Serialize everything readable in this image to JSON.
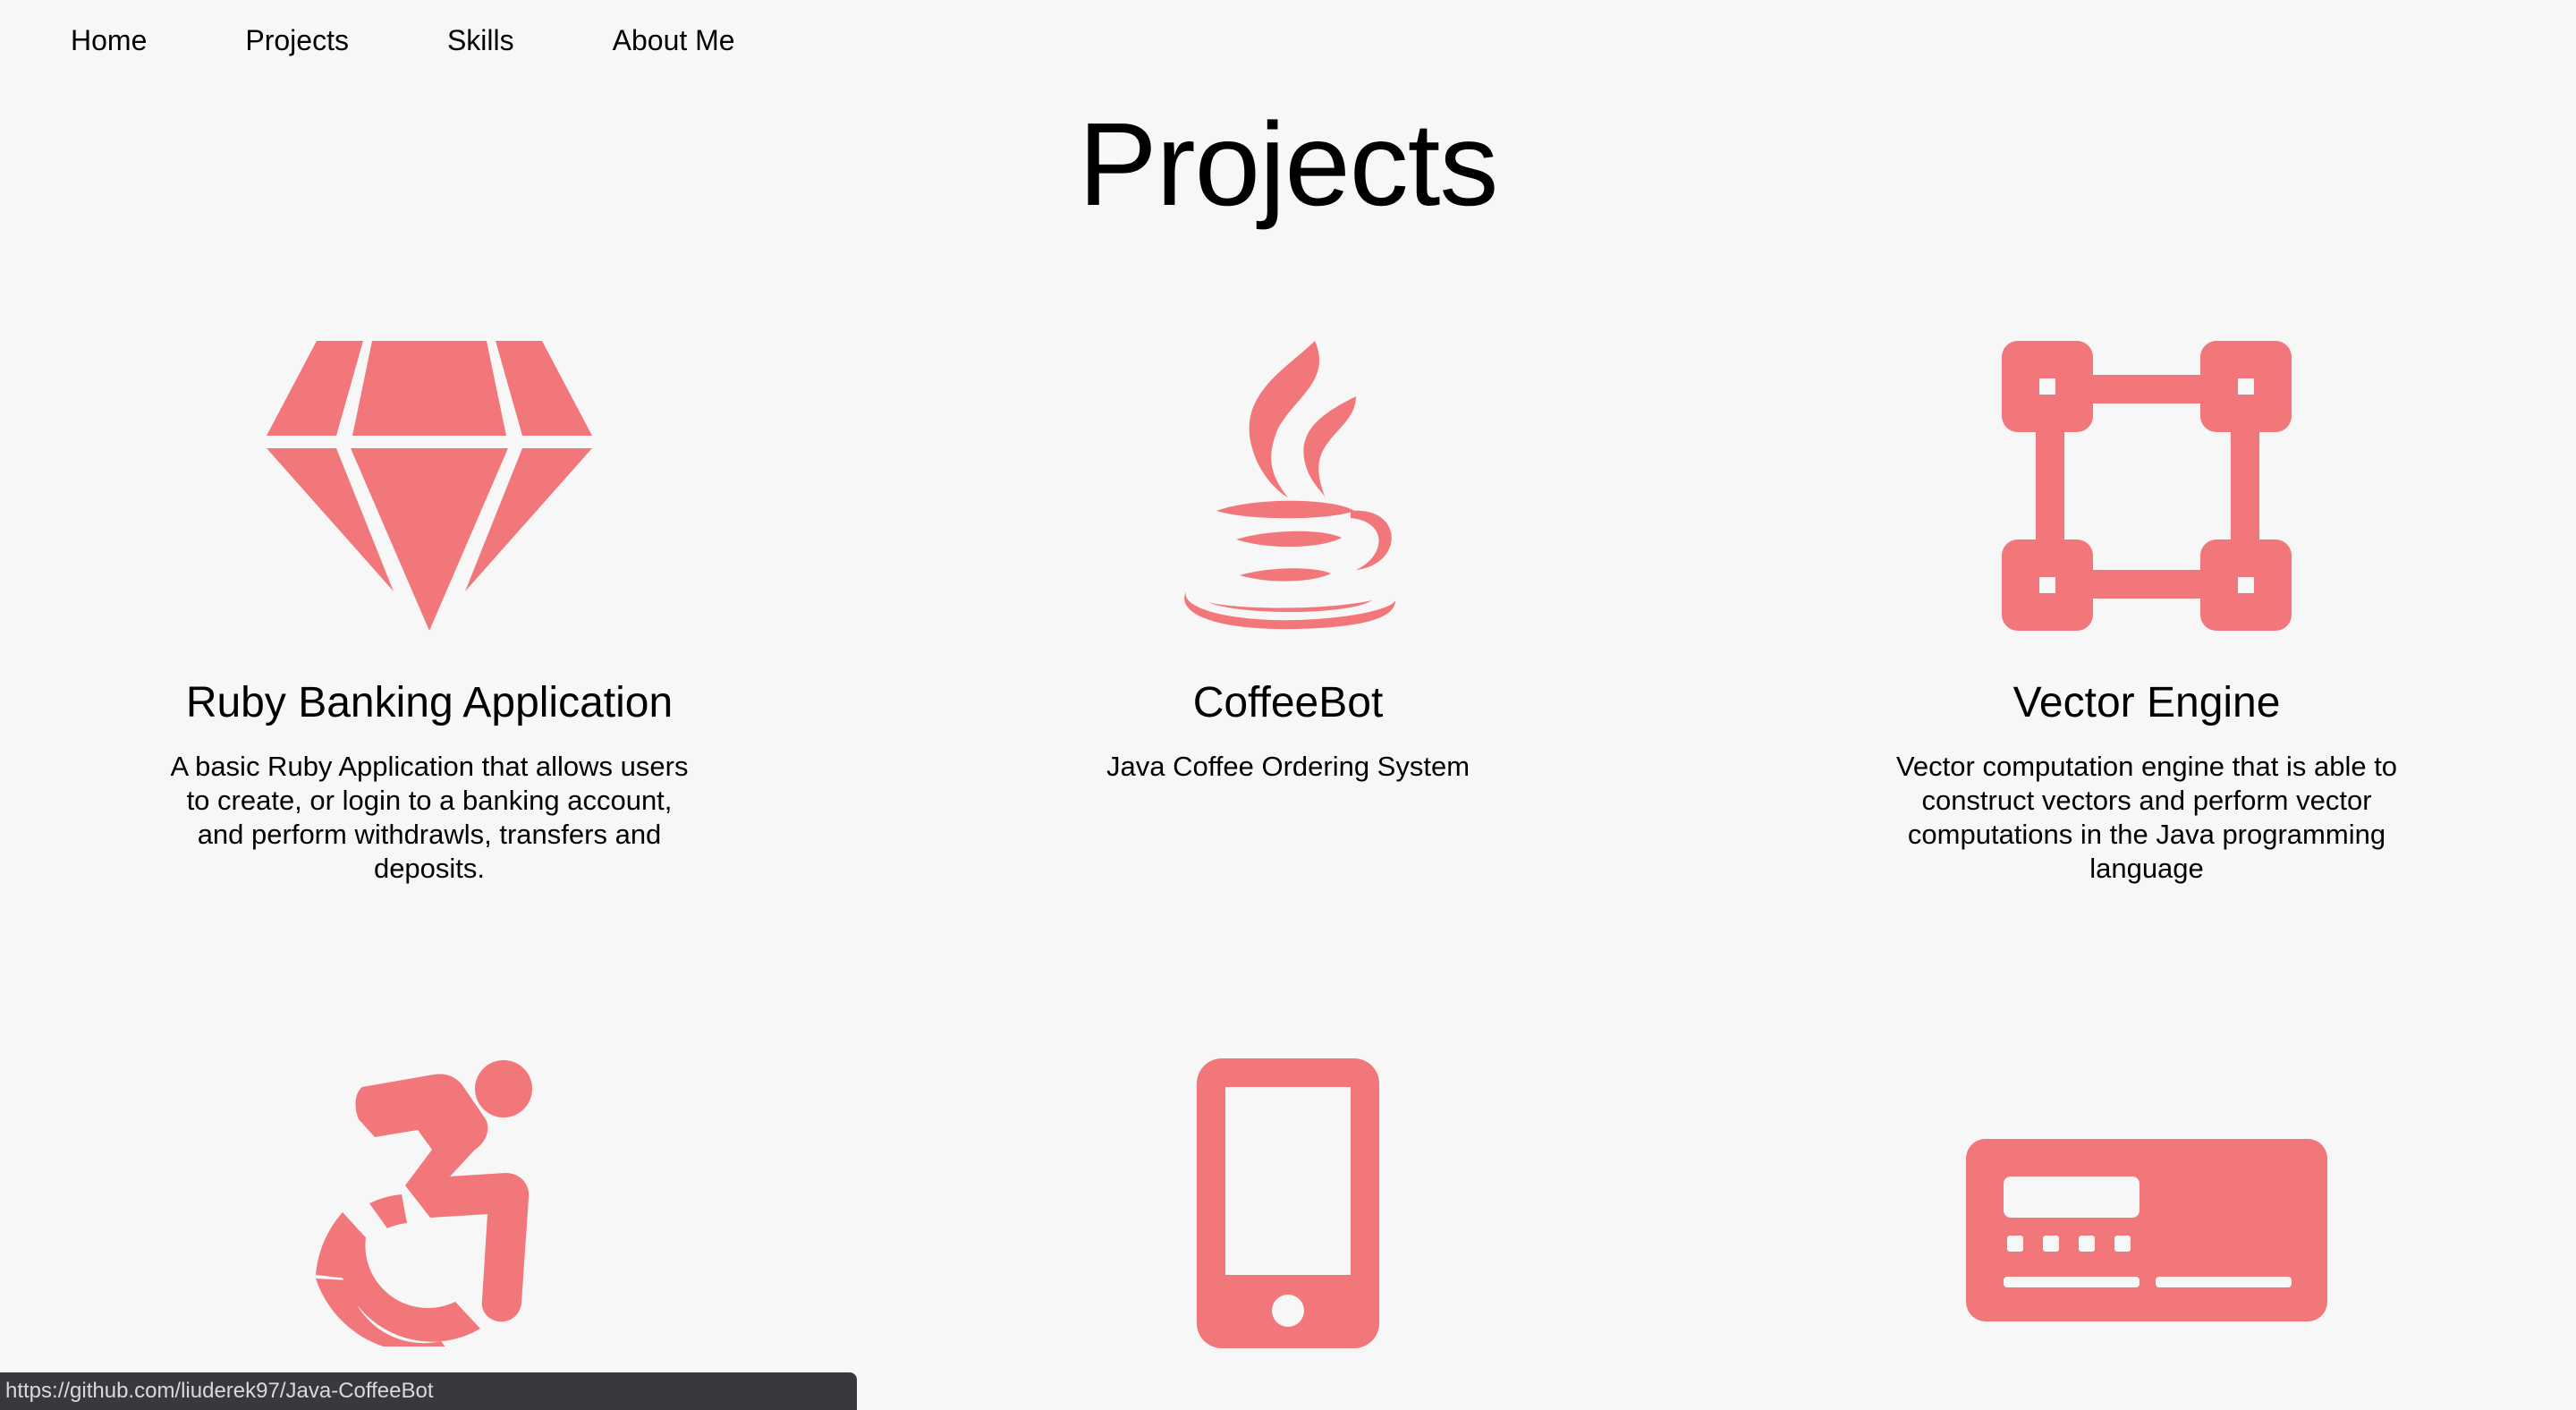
{
  "nav": {
    "items": [
      {
        "label": "Home"
      },
      {
        "label": "Projects"
      },
      {
        "label": "Skills"
      },
      {
        "label": "About Me"
      }
    ]
  },
  "page_title": "Projects",
  "accent_color": "#f2777a",
  "projects": [
    {
      "icon": "gem-icon",
      "title": "Ruby Banking Application",
      "description": "A basic Ruby Application that allows users to create, or login to a banking account, and perform withdrawls, transfers and deposits."
    },
    {
      "icon": "java-coffee-icon",
      "title": "CoffeeBot",
      "description": "Java Coffee Ordering System"
    },
    {
      "icon": "vector-square-icon",
      "title": "Vector Engine",
      "description": "Vector computation engine that is able to construct vectors and perform vector computations in the Java programming language"
    },
    {
      "icon": "accessible-icon",
      "title": "",
      "description": ""
    },
    {
      "icon": "mobile-phone-icon",
      "title": "",
      "description": ""
    },
    {
      "icon": "credit-card-icon",
      "title": "",
      "description": ""
    }
  ],
  "status_bar": {
    "url": "https://github.com/liuderek97/Java-CoffeeBot"
  }
}
